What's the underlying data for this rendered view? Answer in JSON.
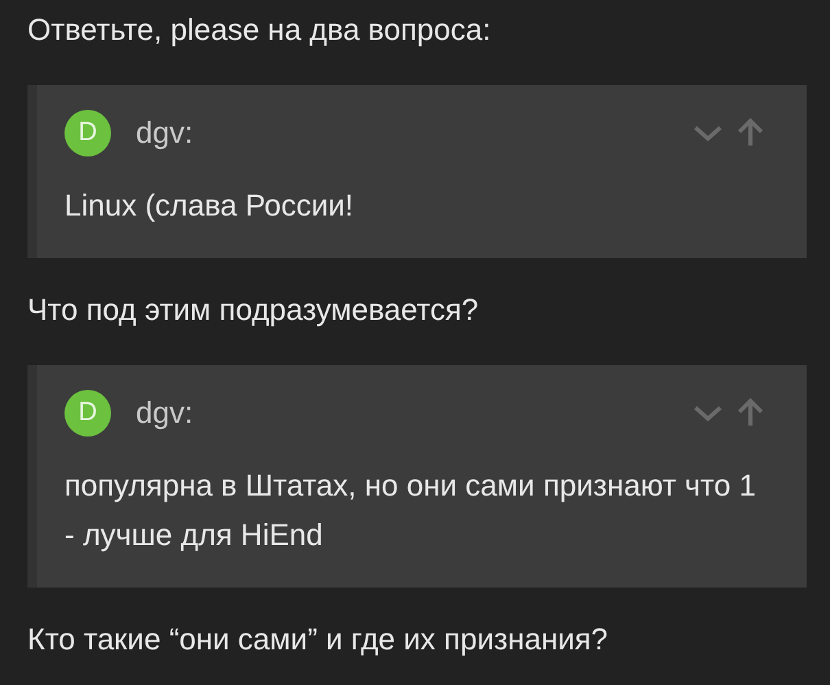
{
  "blocks": [
    {
      "kind": "paragraph",
      "text": "Ответьте, please на два вопроса:"
    },
    {
      "kind": "quote",
      "avatar": "D",
      "author": "dgv:",
      "text": "Linux (слава России!"
    },
    {
      "kind": "paragraph",
      "text": "Что под этим подразумевается?"
    },
    {
      "kind": "quote",
      "avatar": "D",
      "author": "dgv:",
      "text": "популярна в Штатах, но они сами признают что 1 - лучше для HiEnd"
    },
    {
      "kind": "paragraph",
      "text": "Кто такие “они сами” и где их признания?"
    }
  ]
}
